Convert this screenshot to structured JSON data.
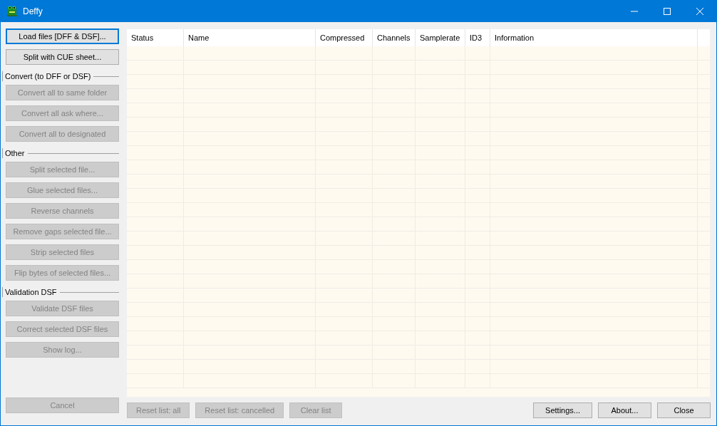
{
  "window": {
    "title": "Deffy"
  },
  "sidebar": [
    {
      "kind": "button",
      "label": "Load files [DFF & DSF]...",
      "disabled": false,
      "focused": true
    },
    {
      "kind": "button",
      "label": "Split with CUE sheet...",
      "disabled": false,
      "focused": false
    },
    {
      "kind": "group",
      "label": "Convert (to DFF or DSF)"
    },
    {
      "kind": "button",
      "label": "Convert all to same folder",
      "disabled": true,
      "focused": false
    },
    {
      "kind": "button",
      "label": "Convert all ask where...",
      "disabled": true,
      "focused": false
    },
    {
      "kind": "button",
      "label": "Convert all to designated",
      "disabled": true,
      "focused": false
    },
    {
      "kind": "group",
      "label": "Other"
    },
    {
      "kind": "button",
      "label": "Split selected file...",
      "disabled": true,
      "focused": false
    },
    {
      "kind": "button",
      "label": "Glue selected files...",
      "disabled": true,
      "focused": false
    },
    {
      "kind": "button",
      "label": "Reverse channels",
      "disabled": true,
      "focused": false
    },
    {
      "kind": "button",
      "label": "Remove gaps selected file...",
      "disabled": true,
      "focused": false
    },
    {
      "kind": "button",
      "label": "Strip selected files",
      "disabled": true,
      "focused": false
    },
    {
      "kind": "button",
      "label": "Flip bytes of selected files...",
      "disabled": true,
      "focused": false
    },
    {
      "kind": "group",
      "label": "Validation DSF"
    },
    {
      "kind": "button",
      "label": "Validate DSF files",
      "disabled": true,
      "focused": false
    },
    {
      "kind": "button",
      "label": "Correct selected DSF files",
      "disabled": true,
      "focused": false
    },
    {
      "kind": "button",
      "label": "Show log...",
      "disabled": true,
      "focused": false
    }
  ],
  "cancel_button": {
    "label": "Cancel",
    "disabled": true
  },
  "table": {
    "columns": [
      "Status",
      "Name",
      "Compressed",
      "Channels",
      "Samplerate",
      "ID3",
      "Information"
    ]
  },
  "list_buttons": [
    {
      "label": "Reset list: all",
      "disabled": true
    },
    {
      "label": "Reset list: cancelled",
      "disabled": true
    },
    {
      "label": "Clear list",
      "disabled": true
    }
  ],
  "dialog_buttons": [
    {
      "label": "Settings...",
      "disabled": false
    },
    {
      "label": "About...",
      "disabled": false
    },
    {
      "label": "Close",
      "disabled": false
    }
  ]
}
